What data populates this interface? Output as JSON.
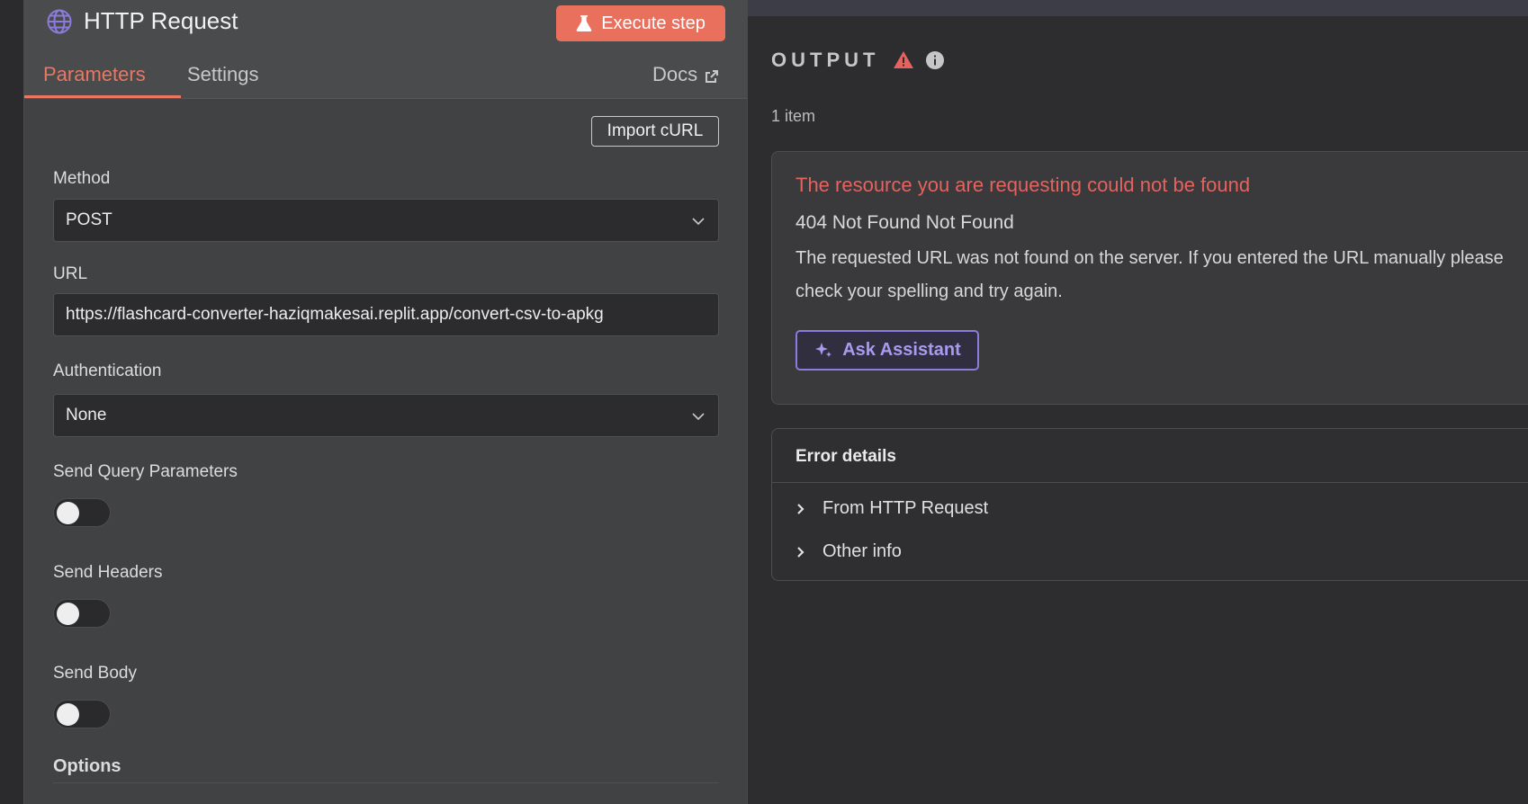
{
  "node": {
    "title": "HTTP Request",
    "execute_label": "Execute step",
    "tabs": [
      "Parameters",
      "Settings"
    ],
    "docs_label": "Docs"
  },
  "parameters": {
    "import_curl_label": "Import cURL",
    "method": {
      "label": "Method",
      "value": "POST"
    },
    "url": {
      "label": "URL",
      "value": "https://flashcard-converter-haziqmakesai.replit.app/convert-csv-to-apkg"
    },
    "authentication": {
      "label": "Authentication",
      "value": "None"
    },
    "send_query_params": {
      "label": "Send Query Parameters",
      "enabled": false
    },
    "send_headers": {
      "label": "Send Headers",
      "enabled": false
    },
    "send_body": {
      "label": "Send Body",
      "enabled": false
    },
    "options_label": "Options"
  },
  "output": {
    "title": "OUTPUT",
    "item_count": "1 item",
    "error": {
      "title": "The resource you are requesting could not be found",
      "status": "404 Not Found Not Found",
      "message": "The requested URL was not found on the server. If you entered the URL manually please check your spelling and try again.",
      "ask_label": "Ask Assistant"
    },
    "details": {
      "title": "Error details",
      "rows": [
        "From HTTP Request",
        "Other info"
      ]
    }
  },
  "colors": {
    "accent": "#ea7762",
    "error": "#e6625e",
    "assistant": "#8c7bdc"
  },
  "icons": {
    "node": "globe-icon",
    "execute": "flask-icon",
    "docs": "external-link-icon",
    "dropdown": "chevron-down-icon",
    "warning": "warning-icon",
    "info": "info-icon",
    "assistant": "sparkle-icon",
    "expand": "chevron-right-icon"
  }
}
